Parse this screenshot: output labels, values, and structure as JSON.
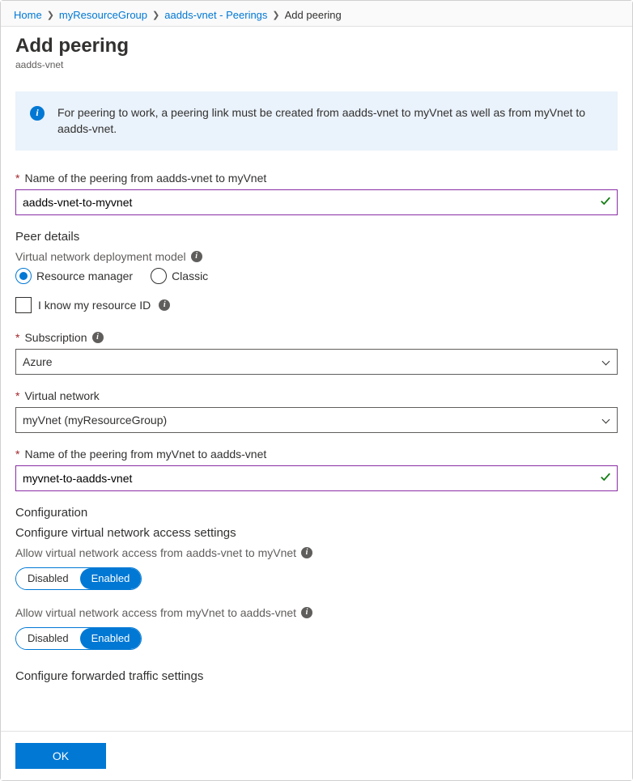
{
  "breadcrumb": {
    "home": "Home",
    "group": "myResourceGroup",
    "vnet": "aadds-vnet - Peerings",
    "current": "Add peering"
  },
  "header": {
    "title": "Add peering",
    "subtitle": "aadds-vnet"
  },
  "info": {
    "text": "For peering to work, a peering link must be created from aadds-vnet to myVnet as well as from myVnet to aadds-vnet."
  },
  "fields": {
    "name1_label": "Name of the peering from aadds-vnet to myVnet",
    "name1_value": "aadds-vnet-to-myvnet",
    "peer_details_title": "Peer details",
    "deploy_model_label": "Virtual network deployment model",
    "radio_rm": "Resource manager",
    "radio_classic": "Classic",
    "know_resource_id": "I know my resource ID",
    "subscription_label": "Subscription",
    "subscription_value": "Azure",
    "vnet_label": "Virtual network",
    "vnet_value": "myVnet (myResourceGroup)",
    "name2_label": "Name of the peering from myVnet to aadds-vnet",
    "name2_value": "myvnet-to-aadds-vnet"
  },
  "config": {
    "title": "Configuration",
    "access_title": "Configure virtual network access settings",
    "allow1_label": "Allow virtual network access from aadds-vnet to myVnet",
    "allow2_label": "Allow virtual network access from myVnet to aadds-vnet",
    "forwarded_title": "Configure forwarded traffic settings",
    "toggle_disabled": "Disabled",
    "toggle_enabled": "Enabled"
  },
  "footer": {
    "ok": "OK"
  }
}
